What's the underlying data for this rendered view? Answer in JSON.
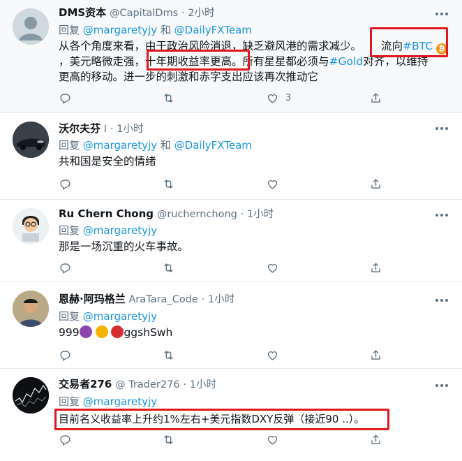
{
  "tweets": [
    {
      "name": "DMS资本",
      "handle": "@CapitalDms",
      "time": "2小时",
      "reply_prefix": "回复",
      "mention1": "@margaretyjy",
      "conj": "和",
      "mention2": "@DailyFXTeam",
      "line1": "从各个角度来看，由于政治风险消退，缺乏避风港的需求减少。",
      "line1b": "流向",
      "btc": "#BTC",
      "line2a": "，美元略微走强，",
      "line2b": "十年期收益率更高。",
      "line2c": "所有星星都必须与",
      "gold": "#Gold",
      "line2d": "对齐，以维持",
      "line3": "更高的移动。进一步的刺激和赤字支出应该再次推动它",
      "like_count": "3"
    },
    {
      "name": "沃尔夫芬",
      "handle": "I",
      "time": "1小时",
      "reply_prefix": "回复",
      "mention1": "@margaretyjy",
      "conj": "和",
      "mention2": "@DailyFXTeam",
      "text": "共和国是安全的情绪"
    },
    {
      "name": "Ru Chern Chong",
      "handle": "@ruchernchong",
      "time": "1小时",
      "reply_prefix": "回复",
      "mention1": "@margaretyjy",
      "text": "那是一场沉重的火车事故。"
    },
    {
      "name": "恩赫·阿玛格兰",
      "handle": "AraTara_Code",
      "time": "1小时",
      "reply_prefix": "回复",
      "mention1": "@margaretyjy",
      "text_a": "999",
      "text_b": "ggshSwh"
    },
    {
      "name": "交易者276",
      "handle": "@ Trader276",
      "time": "1小时",
      "reply_prefix": "回复",
      "mention1": "@margaretyjy",
      "text": "目前名义收益率上升约1%左右+美元指数DXY反弹（接近90 ..）。"
    }
  ],
  "separator": "·",
  "icons": [
    "reply-icon",
    "retweet-icon",
    "like-icon",
    "share-icon",
    "more-icon"
  ],
  "colors": {
    "link": "#1b95e0",
    "muted": "#5b7083",
    "highlight_box": "#e0181e",
    "btc": "#f7931a"
  }
}
